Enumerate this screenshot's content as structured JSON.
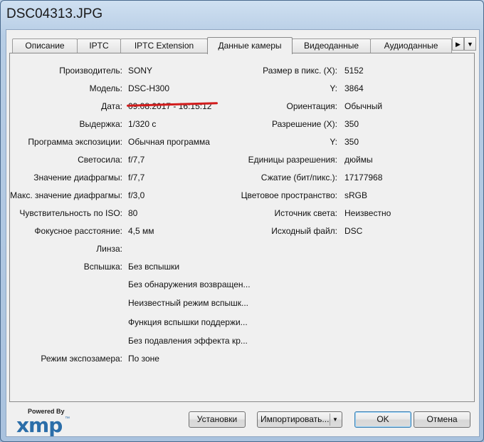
{
  "window": {
    "title": "DSC04313.JPG"
  },
  "tabs": [
    {
      "label": "Описание",
      "active": false
    },
    {
      "label": "IPTC",
      "active": false
    },
    {
      "label": "IPTC Extension",
      "active": false
    },
    {
      "label": "Данные камеры",
      "active": true
    },
    {
      "label": "Видеоданные",
      "active": false
    },
    {
      "label": "Аудиоданные",
      "active": false
    }
  ],
  "tab_scroll": {
    "right": "▶",
    "menu": "▼"
  },
  "left_fields": [
    {
      "label": "Производитель:",
      "value": "SONY"
    },
    {
      "label": "Модель:",
      "value": "DSC-H300"
    },
    {
      "label": "Дата:",
      "value": "09.08.2017 - 16:15:12",
      "strikethrough": true
    },
    {
      "label": "Выдержка:",
      "value": "1/320 с"
    },
    {
      "label": "Программа экспозиции:",
      "value": "Обычная программа"
    },
    {
      "label": "Светосила:",
      "value": "f/7,7"
    },
    {
      "label": "Значение диафрагмы:",
      "value": "f/7,7"
    },
    {
      "label": "Макс. значение диафрагмы:",
      "value": "f/3,0"
    },
    {
      "label": "Чувствительность по ISO:",
      "value": "80"
    },
    {
      "label": "Фокусное расстояние:",
      "value": "4,5 мм"
    },
    {
      "label": "Линза:",
      "value": ""
    },
    {
      "label": "Вспышка:",
      "value": "Без вспышки"
    }
  ],
  "flash_extra": [
    "Без обнаружения возвращен...",
    "Неизвестный режим вспышк...",
    "Функция вспышки поддержи...",
    "Без подавления эффекта кр..."
  ],
  "metering": {
    "label": "Режим экспозамера:",
    "value": "По зоне"
  },
  "right_fields": [
    {
      "label": "Размер в пикс. (X):",
      "value": "5152"
    },
    {
      "label": "Y:",
      "value": "3864"
    },
    {
      "label": "Ориентация:",
      "value": "Обычный"
    },
    {
      "label": "Разрешение (X):",
      "value": "350"
    },
    {
      "label": "Y:",
      "value": "350"
    },
    {
      "label": "Единицы разрешения:",
      "value": "дюймы"
    },
    {
      "label": "Сжатие (бит/пикс.):",
      "value": "17177968"
    },
    {
      "label": "Цветовое пространство:",
      "value": "sRGB"
    },
    {
      "label": "Источник света:",
      "value": "Неизвестно"
    },
    {
      "label": "Исходный файл:",
      "value": "DSC"
    }
  ],
  "buttons": {
    "settings": "Установки",
    "import": "Импортировать...",
    "import_arrow": "▼",
    "ok": "OK",
    "cancel": "Отмена"
  },
  "logo": {
    "powered_by": "Powered By",
    "brand": "xmp",
    "tm": "™"
  },
  "colors": {
    "accent": "#2b6ea9",
    "strike": "#d21c1c"
  }
}
